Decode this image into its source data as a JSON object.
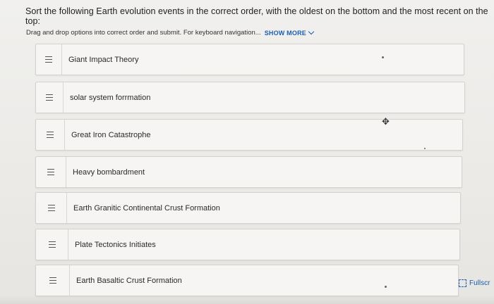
{
  "question": {
    "text": "Sort the following Earth evolution events in the correct order, with the oldest on the bottom and the most recent on the top:"
  },
  "hint": {
    "text": "Drag and drop options into correct order and submit. For keyboard navigation...",
    "show_more_label": "SHOW MORE",
    "show_more_icon": "chevron-down-icon"
  },
  "items": [
    {
      "label": "Giant Impact Theory",
      "icon": "drag-handle-icon"
    },
    {
      "label": "solar system forrmation",
      "icon": "drag-handle-icon"
    },
    {
      "label": "Great Iron Catastrophe",
      "icon": "drag-handle-icon"
    },
    {
      "label": "Heavy bombardment",
      "icon": "drag-handle-icon"
    },
    {
      "label": "Earth Granitic Continental Crust Formation",
      "icon": "drag-handle-icon"
    },
    {
      "label": "Plate Tectonics Initiates",
      "icon": "drag-handle-icon"
    },
    {
      "label": "Earth Basaltic Crust Formation",
      "icon": "drag-handle-icon"
    }
  ],
  "cursor": {
    "icon": "move-cursor-icon",
    "glyph": "✥"
  },
  "fullscreen": {
    "label": "Fullscr",
    "icon": "fullscreen-icon"
  },
  "colors": {
    "link": "#1b5fb0",
    "item_bg": "#f6f5f3",
    "item_border": "#d3d2cf",
    "page_bg": "#ecebe9"
  }
}
